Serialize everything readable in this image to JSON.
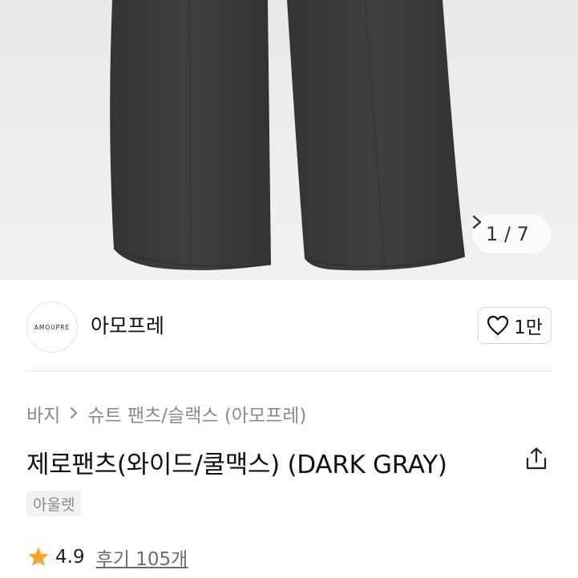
{
  "gallery": {
    "counter_text": "1 / 7",
    "current": 1,
    "total": 7
  },
  "seller": {
    "logo_text": "AMOUPRE",
    "name": "아모프레",
    "likes_label": "1만"
  },
  "breadcrumb": {
    "items": [
      "바지",
      "슈트 팬츠/슬랙스 (아모프레)"
    ]
  },
  "product": {
    "title": "제로팬츠(와이드/쿨맥스) (DARK GRAY)",
    "tag": "아울렛"
  },
  "rating": {
    "score": "4.9",
    "reviews_label": "후기 105개"
  },
  "colors": {
    "star": "#f4a62a",
    "pants": "#3b3b3d",
    "background_gray": "#ececec"
  },
  "icons": {
    "next": "chevron-right-icon",
    "like": "heart-outline-icon",
    "share": "share-icon",
    "rating": "star-icon"
  }
}
